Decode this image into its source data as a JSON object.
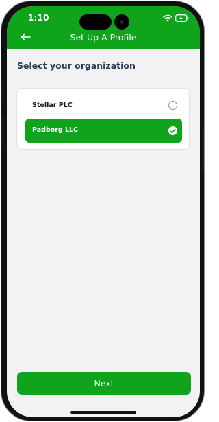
{
  "status_bar": {
    "time": "1:10",
    "icons": [
      "wifi-icon",
      "battery-charging-icon"
    ]
  },
  "header": {
    "title": "Set Up A Profile",
    "back_icon": "arrow-left-icon"
  },
  "main": {
    "section_title": "Select your organization",
    "organizations": [
      {
        "label": "Stellar PLC",
        "selected": false
      },
      {
        "label": "Padberg LLC",
        "selected": true
      }
    ]
  },
  "footer": {
    "next_label": "Next"
  },
  "colors": {
    "brand_green": "#0fa41c",
    "heading_text": "#2d3b55",
    "screen_background": "#f2f2f4"
  }
}
